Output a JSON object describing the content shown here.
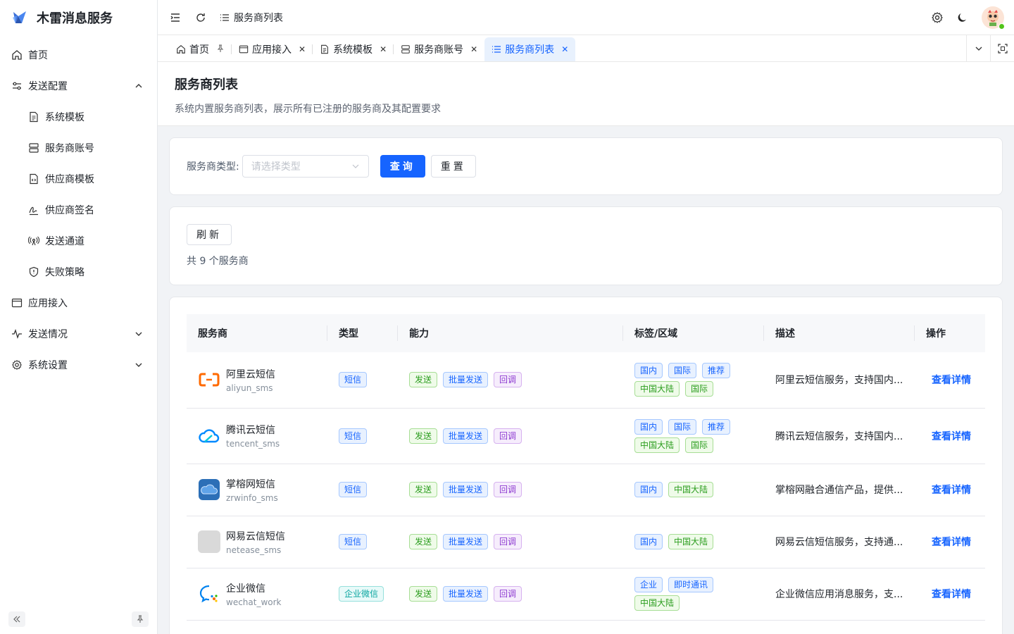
{
  "app": {
    "title": "木雷消息服务"
  },
  "sidebar": {
    "items": [
      {
        "label": "首页",
        "icon": "home-icon",
        "level": 0
      },
      {
        "label": "发送配置",
        "icon": "sliders-icon",
        "level": 0,
        "expanded": true
      },
      {
        "label": "系统模板",
        "icon": "file-text-icon",
        "level": 1
      },
      {
        "label": "服务商账号",
        "icon": "server-icon",
        "level": 1
      },
      {
        "label": "供应商模板",
        "icon": "file-code-icon",
        "level": 1
      },
      {
        "label": "供应商签名",
        "icon": "signature-icon",
        "level": 1
      },
      {
        "label": "发送通道",
        "icon": "antenna-icon",
        "level": 1
      },
      {
        "label": "失败策略",
        "icon": "shield-icon",
        "level": 1
      },
      {
        "label": "应用接入",
        "icon": "window-icon",
        "level": 0
      },
      {
        "label": "发送情况",
        "icon": "activity-icon",
        "level": 0,
        "expanded": false
      },
      {
        "label": "系统设置",
        "icon": "gear-icon",
        "level": 0,
        "expanded": false
      }
    ]
  },
  "header": {
    "breadcrumb": "服务商列表"
  },
  "tabs": [
    {
      "label": "首页",
      "icon": "home-icon",
      "pinned": true
    },
    {
      "label": "应用接入",
      "icon": "window-icon"
    },
    {
      "label": "系统模板",
      "icon": "file-text-icon"
    },
    {
      "label": "服务商账号",
      "icon": "server-icon"
    },
    {
      "label": "服务商列表",
      "icon": "list-icon",
      "active": true
    }
  ],
  "page": {
    "title": "服务商列表",
    "description": "系统内置服务商列表，展示所有已注册的服务商及其配置要求"
  },
  "filter": {
    "label": "服务商类型:",
    "placeholder": "请选择类型",
    "query_label": "查询",
    "reset_label": "重置"
  },
  "toolbar": {
    "refresh_label": "刷新",
    "count_text": "共 9 个服务商"
  },
  "table": {
    "columns": [
      "服务商",
      "类型",
      "能力",
      "标签/区域",
      "描述",
      "操作"
    ],
    "rows": [
      {
        "name": "阿里云短信",
        "code": "aliyun_sms",
        "logo": "aliyun-logo-icon",
        "type": "短信",
        "type_color": "blue",
        "abilities": [
          "发送",
          "批量发送",
          "回调"
        ],
        "tags": [
          [
            "国内",
            "blue"
          ],
          [
            "国际",
            "blue"
          ],
          [
            "推荐",
            "blue"
          ],
          [
            "中国大陆",
            "green"
          ],
          [
            "国际",
            "green"
          ]
        ],
        "desc": "阿里云短信服务，支持国内...",
        "action": "查看详情"
      },
      {
        "name": "腾讯云短信",
        "code": "tencent_sms",
        "logo": "tencent-cloud-logo-icon",
        "type": "短信",
        "type_color": "blue",
        "abilities": [
          "发送",
          "批量发送",
          "回调"
        ],
        "tags": [
          [
            "国内",
            "blue"
          ],
          [
            "国际",
            "blue"
          ],
          [
            "推荐",
            "blue"
          ],
          [
            "中国大陆",
            "green"
          ],
          [
            "国际",
            "green"
          ]
        ],
        "desc": "腾讯云短信服务，支持国内...",
        "action": "查看详情"
      },
      {
        "name": "掌榕网短信",
        "code": "zrwinfo_sms",
        "logo": "cloud-logo-icon",
        "type": "短信",
        "type_color": "blue",
        "abilities": [
          "发送",
          "批量发送",
          "回调"
        ],
        "tags": [
          [
            "国内",
            "blue"
          ],
          [
            "中国大陆",
            "green"
          ]
        ],
        "desc": "掌榕网融合通信产品，提供...",
        "action": "查看详情"
      },
      {
        "name": "网易云信短信",
        "code": "netease_sms",
        "logo": "placeholder-logo-icon",
        "type": "短信",
        "type_color": "blue",
        "abilities": [
          "发送",
          "批量发送",
          "回调"
        ],
        "tags": [
          [
            "国内",
            "blue"
          ],
          [
            "中国大陆",
            "green"
          ]
        ],
        "desc": "网易云信短信服务，支持通...",
        "action": "查看详情"
      },
      {
        "name": "企业微信",
        "code": "wechat_work",
        "logo": "wechat-work-logo-icon",
        "type": "企业微信",
        "type_color": "cyan",
        "abilities": [
          "发送",
          "批量发送",
          "回调"
        ],
        "tags": [
          [
            "企业",
            "blue"
          ],
          [
            "即时通讯",
            "blue"
          ],
          [
            "中国大陆",
            "green"
          ]
        ],
        "desc": "企业微信应用消息服务，支...",
        "action": "查看详情"
      }
    ]
  },
  "colors": {
    "primary": "#1664ff",
    "active_tab_bg": "#e8f1fd"
  }
}
